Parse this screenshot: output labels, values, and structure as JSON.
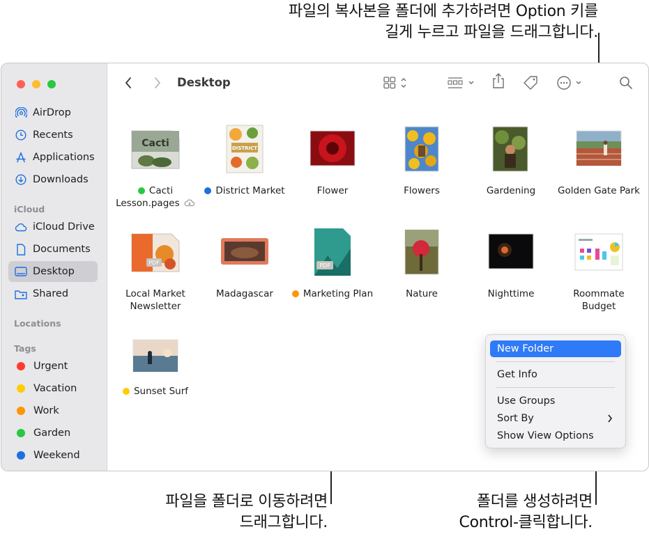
{
  "callouts": {
    "top_line1": "파일의 복사본을 폴더에 추가하려면 Option 키를",
    "top_line2": "길게 누르고 파일을 드래그합니다.",
    "bottom_left_line1": "파일을 폴더로 이동하려면",
    "bottom_left_line2": "드래그합니다.",
    "bottom_right_line1": "폴더를 생성하려면",
    "bottom_right_line2": "Control-클릭합니다."
  },
  "sidebar": {
    "items": [
      {
        "label": "AirDrop",
        "icon": "airdrop-icon"
      },
      {
        "label": "Recents",
        "icon": "clock-icon"
      },
      {
        "label": "Applications",
        "icon": "applications-icon"
      },
      {
        "label": "Downloads",
        "icon": "downloads-icon"
      }
    ],
    "icloud_header": "iCloud",
    "icloud_items": [
      {
        "label": "iCloud Drive",
        "icon": "cloud-icon"
      },
      {
        "label": "Documents",
        "icon": "document-icon"
      },
      {
        "label": "Desktop",
        "icon": "desktop-icon",
        "selected": true
      },
      {
        "label": "Shared",
        "icon": "shared-folder-icon"
      }
    ],
    "locations_header": "Locations",
    "tags_header": "Tags",
    "tags": [
      {
        "label": "Urgent",
        "color": "#ff3b30"
      },
      {
        "label": "Vacation",
        "color": "#ffcc00"
      },
      {
        "label": "Work",
        "color": "#ff9500"
      },
      {
        "label": "Garden",
        "color": "#28c840"
      },
      {
        "label": "Weekend",
        "color": "#1e6fe0"
      }
    ]
  },
  "toolbar": {
    "title": "Desktop"
  },
  "files": [
    {
      "name": "Cacti",
      "name2": "Lesson.pages",
      "tag": "#28c840",
      "cloud": true
    },
    {
      "name": "District Market",
      "tag": "#1e6fe0"
    },
    {
      "name": "Flower"
    },
    {
      "name": "Flowers"
    },
    {
      "name": "Gardening"
    },
    {
      "name": "Golden Gate Park"
    },
    {
      "name": "Local Market",
      "name2": "Newsletter"
    },
    {
      "name": "Madagascar"
    },
    {
      "name": "Marketing Plan",
      "tag": "#ff9500"
    },
    {
      "name": "Nature"
    },
    {
      "name": "Nighttime"
    },
    {
      "name": "Roommate",
      "name2": "Budget"
    },
    {
      "name": "Sunset Surf",
      "tag": "#ffcc00"
    }
  ],
  "context_menu": {
    "new_folder": "New Folder",
    "get_info": "Get Info",
    "use_groups": "Use Groups",
    "sort_by": "Sort By",
    "show_view_options": "Show View Options"
  }
}
